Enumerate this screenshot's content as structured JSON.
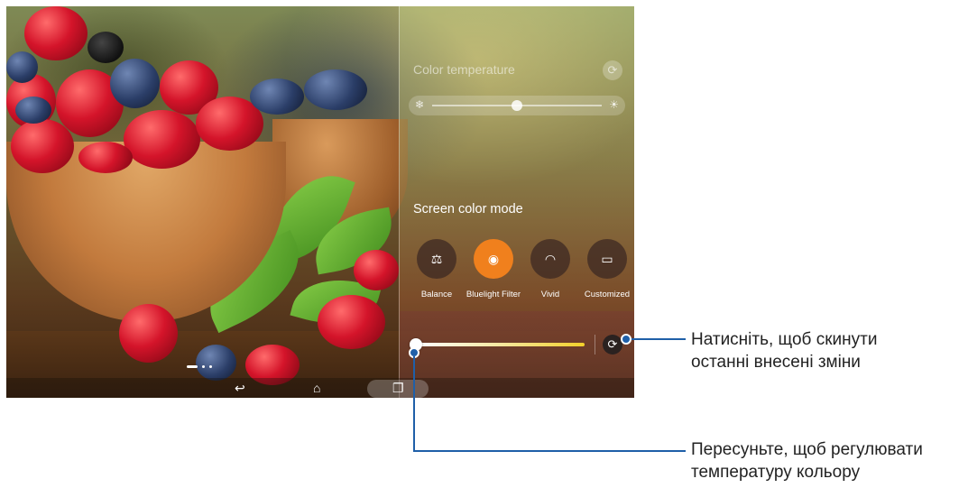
{
  "panel": {
    "color_temperature_title": "Color temperature",
    "screen_color_mode_title": "Screen color mode",
    "modes": [
      {
        "label": "Balance",
        "icon": "balance-scale-icon",
        "glyph": "⚖",
        "active": false
      },
      {
        "label": "Bluelight Filter",
        "icon": "eye-shield-icon",
        "glyph": "◉",
        "active": true
      },
      {
        "label": "Vivid",
        "icon": "rainbow-icon",
        "glyph": "◠",
        "active": false
      },
      {
        "label": "Customized",
        "icon": "screen-settings-icon",
        "glyph": "▭",
        "active": false
      }
    ],
    "accent_color": "#f0801d",
    "color_temperature_level": 0.5,
    "filter_slider_level": 0.0
  },
  "callouts": {
    "reset": [
      "Натисніть, щоб скинути",
      "останні внесені зміни"
    ],
    "slider": [
      "Пересуньте, щоб регулювати",
      "температуру кольору"
    ],
    "line_color": "#1f5fa8"
  }
}
